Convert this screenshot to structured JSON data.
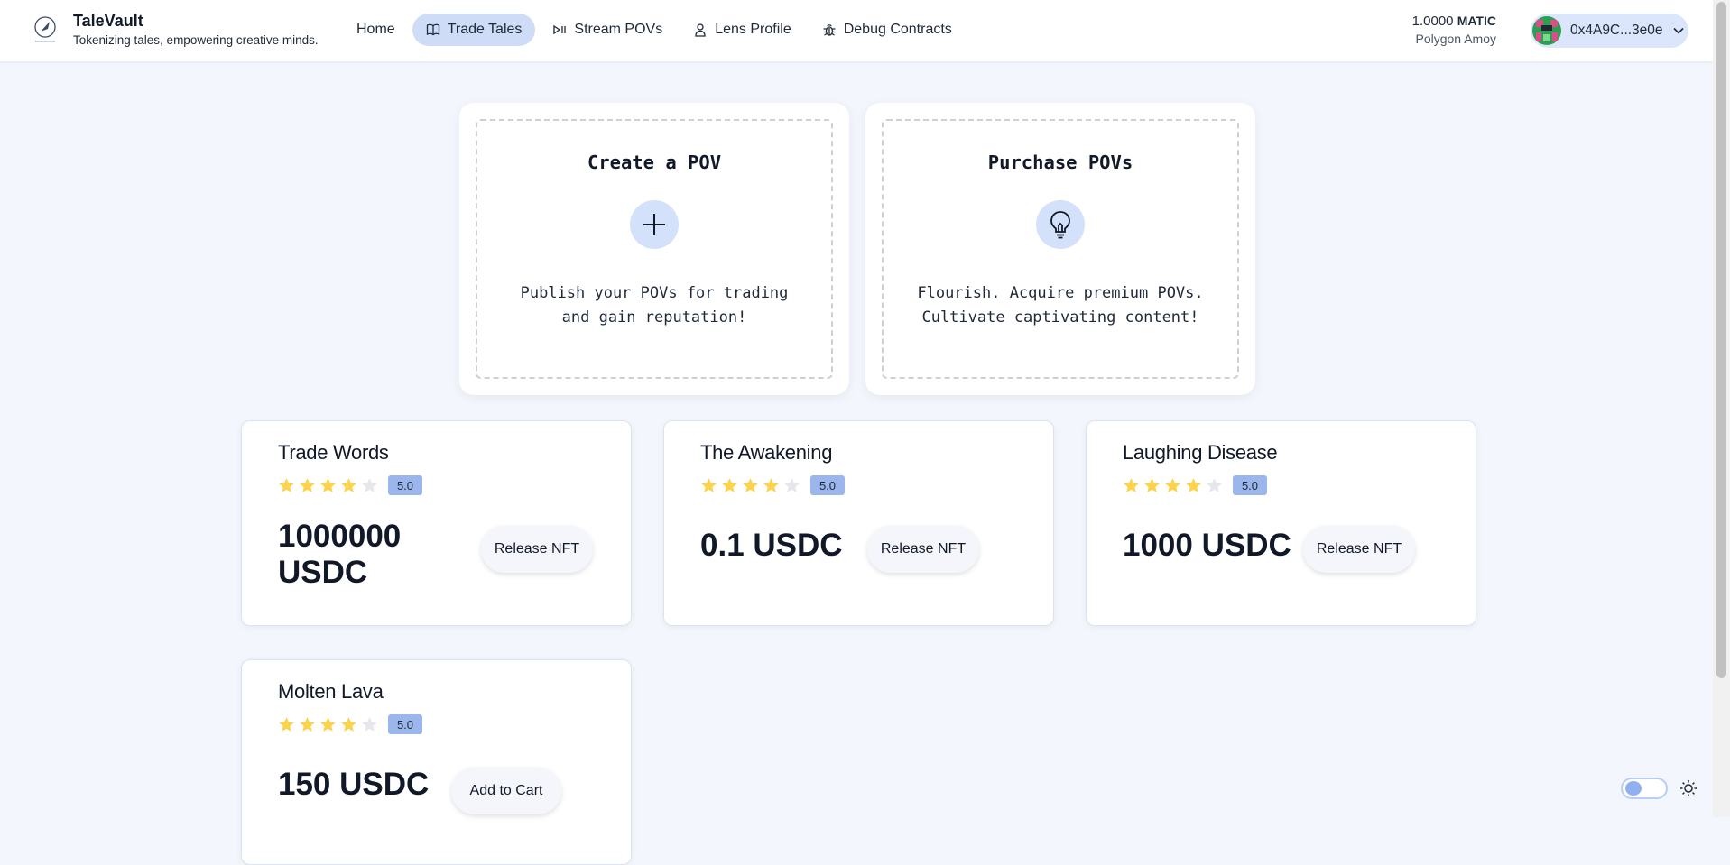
{
  "header": {
    "brand": {
      "title": "TaleVault",
      "tagline": "Tokenizing tales, empowering creative minds."
    },
    "nav": [
      {
        "label": "Home",
        "icon": "",
        "active": false
      },
      {
        "label": "Trade Tales",
        "icon": "book-icon",
        "active": true
      },
      {
        "label": "Stream POVs",
        "icon": "play-pause-icon",
        "active": false
      },
      {
        "label": "Lens Profile",
        "icon": "user-icon",
        "active": false
      },
      {
        "label": "Debug Contracts",
        "icon": "bug-icon",
        "active": false
      }
    ],
    "balance": {
      "amount": "1.0000",
      "unit": "MATIC",
      "network": "Polygon Amoy"
    },
    "wallet": {
      "address": "0x4A9C...3e0e"
    }
  },
  "actions": [
    {
      "title": "Create a POV",
      "icon": "plus-icon",
      "description": "Publish your POVs for trading and gain reputation!"
    },
    {
      "title": "Purchase POVs",
      "icon": "lightbulb-icon",
      "description": "Flourish. Acquire premium POVs. Cultivate captivating content!"
    }
  ],
  "products": [
    {
      "title": "Trade Words",
      "rating": "5.0",
      "stars_filled": 4,
      "price": "1000000 USDC",
      "button": "Release NFT"
    },
    {
      "title": "The Awakening",
      "rating": "5.0",
      "stars_filled": 4,
      "price": "0.1 USDC",
      "button": "Release NFT"
    },
    {
      "title": "Laughing Disease",
      "rating": "5.0",
      "stars_filled": 4,
      "price": "1000 USDC",
      "button": "Release NFT"
    },
    {
      "title": "Molten Lava",
      "rating": "5.0",
      "stars_filled": 4,
      "price": "150 USDC",
      "button": "Add to Cart"
    }
  ],
  "colors": {
    "accent": "#cfdcf8",
    "star_filled": "#fbd34d",
    "star_empty": "#e5e7eb",
    "rating_badge": "#9bb6ec",
    "page_background": "#f3f6fd"
  }
}
